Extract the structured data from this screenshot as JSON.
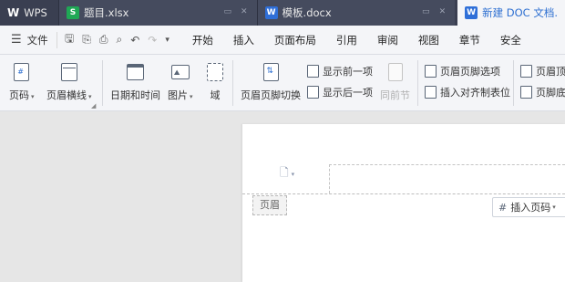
{
  "tabs": {
    "app": "WPS",
    "tab1": {
      "name": "题目.xlsx",
      "type_badge": "S"
    },
    "tab2": {
      "name": "模板.docx",
      "type_badge": "W"
    },
    "tab3": {
      "name": "新建 DOC 文档.",
      "type_badge": "W"
    }
  },
  "menubar": {
    "file_label": "文件",
    "items": [
      "开始",
      "插入",
      "页面布局",
      "引用",
      "审阅",
      "视图",
      "章节",
      "安全"
    ]
  },
  "ribbon": {
    "page_number": "页码",
    "header_line": "页眉横线",
    "date_time": "日期和时间",
    "picture": "图片",
    "field": "域",
    "switch_header_footer": "页眉页脚切换",
    "show_previous": "显示前一项",
    "show_next": "显示后一项",
    "same_as_previous": "同前节",
    "header_footer_options": "页眉页脚选项",
    "insert_alignment_tab": "插入对齐制表位",
    "header_top": "页眉顶",
    "footer_bottom": "页脚底"
  },
  "document": {
    "header_label": "页眉",
    "insert_page_number": "插入页码"
  },
  "colors": {
    "tabbar_bg": "#3a3f51",
    "active_tab_text": "#2d6fd1",
    "ribbon_bg": "#f4f5f8",
    "workspace_bg": "#e6e6e6"
  }
}
